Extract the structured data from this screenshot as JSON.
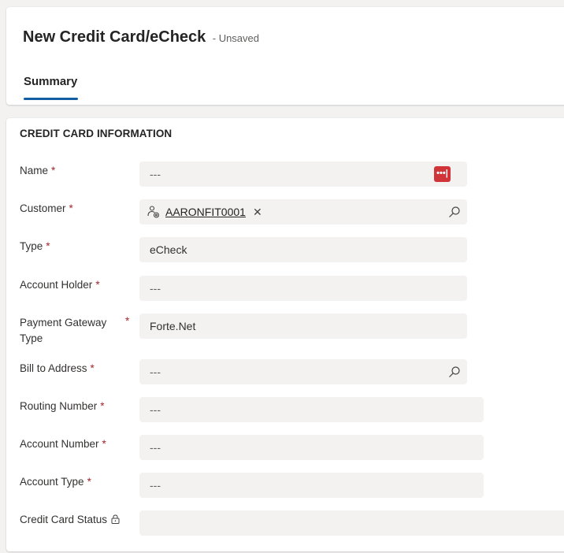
{
  "header": {
    "title": "New Credit Card/eCheck",
    "status": "- Unsaved",
    "tabs": [
      {
        "label": "Summary",
        "active": true
      }
    ]
  },
  "section": {
    "title": "CREDIT CARD INFORMATION"
  },
  "fields": {
    "name": {
      "label": "Name",
      "required": "*",
      "value": "---"
    },
    "customer": {
      "label": "Customer",
      "required": "*",
      "value": "AARONFIT0001",
      "remove_glyph": "✕"
    },
    "type": {
      "label": "Type",
      "required": "*",
      "value": "eCheck"
    },
    "account_holder": {
      "label": "Account Holder",
      "required": "*",
      "value": "---"
    },
    "payment_gateway_type": {
      "label": "Payment Gateway Type",
      "required": "*",
      "value": "Forte.Net"
    },
    "bill_to_address": {
      "label": "Bill to Address",
      "required": "*",
      "value": "---"
    },
    "routing_number": {
      "label": "Routing Number",
      "required": "*",
      "value": "---"
    },
    "account_number": {
      "label": "Account Number",
      "required": "*",
      "value": "---"
    },
    "account_type": {
      "label": "Account Type",
      "required": "*",
      "value": "---"
    },
    "credit_card_status": {
      "label": "Credit Card Status",
      "value": ""
    }
  },
  "badge": {
    "glyph": "•••|"
  },
  "colors": {
    "accent": "#115ea3",
    "required": "#a4262c",
    "badge": "#d13438",
    "field_background": "#f3f2f1"
  },
  "icons": [
    "record-lookup-icon",
    "search-icon",
    "lock-icon",
    "password-manager-icon"
  ]
}
